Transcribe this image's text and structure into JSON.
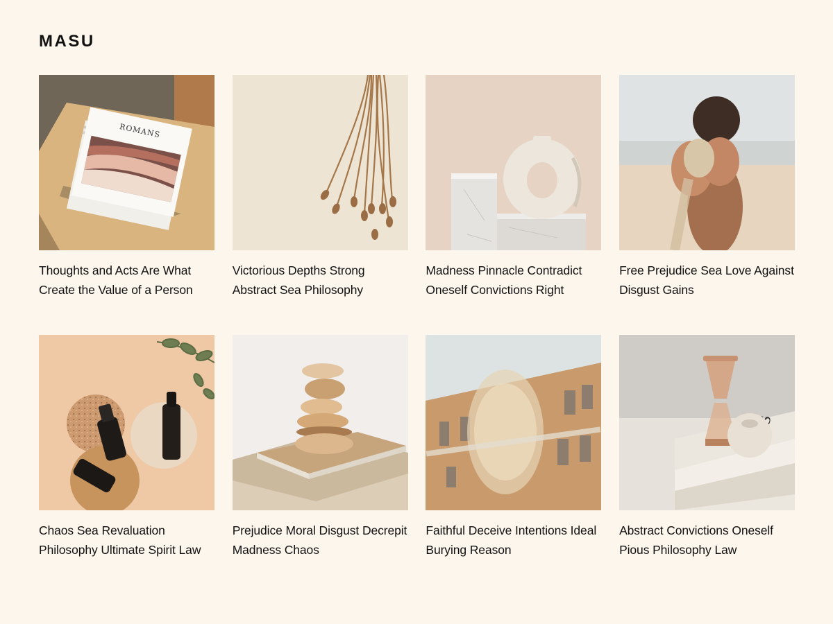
{
  "site": {
    "logo": "MASU"
  },
  "book_cover_text": "ROMANS",
  "posts": [
    {
      "title": "Thoughts and Acts Are What Create the Value of a Person",
      "image": "magazine-on-table"
    },
    {
      "title": "Victorious Depths Strong Abstract Sea Philosophy",
      "image": "dried-poppy-stems"
    },
    {
      "title": "Madness Pinnacle Contradict Oneself Convictions Right",
      "image": "ring-vase-on-marble"
    },
    {
      "title": "Free Prejudice Sea Love Against Disgust Gains",
      "image": "hands-with-sand-beach"
    },
    {
      "title": "Chaos Sea Revaluation Philosophy Ultimate Spirit Law",
      "image": "serum-bottles-coasters"
    },
    {
      "title": "Prejudice Moral Disgust Decrepit Madness Chaos",
      "image": "stacked-wooden-stones"
    },
    {
      "title": "Faithful Deceive Intentions Ideal Burying Reason",
      "image": "woman-window-reflection"
    },
    {
      "title": "Abstract Convictions Oneself Pious Philosophy Law",
      "image": "hourglass-on-books"
    }
  ]
}
